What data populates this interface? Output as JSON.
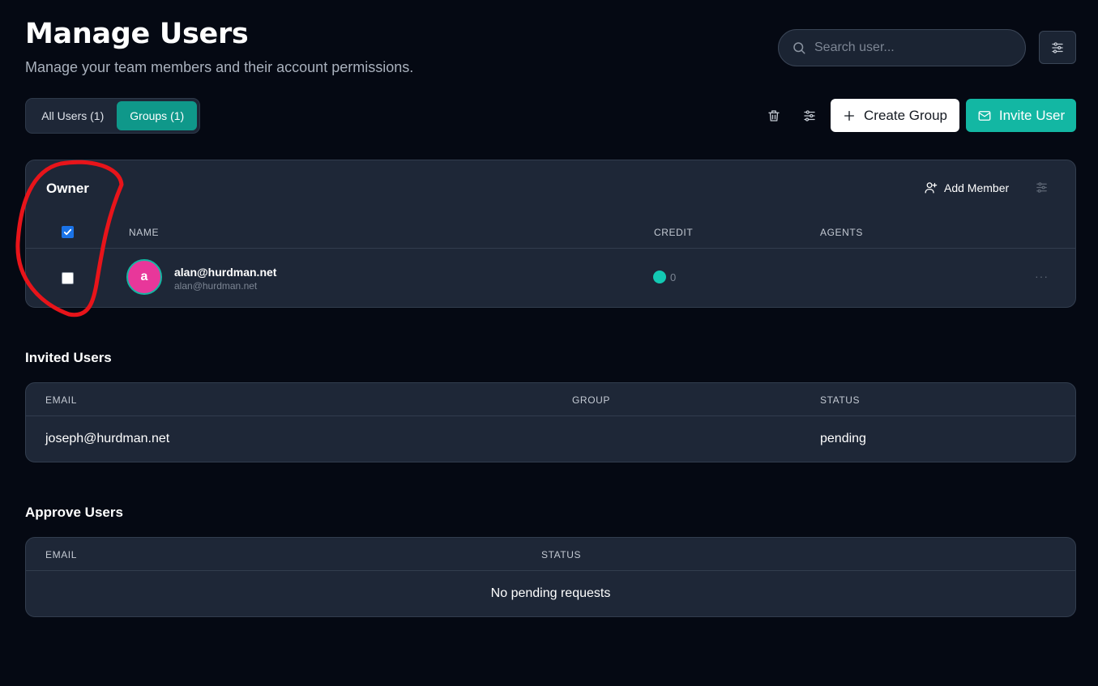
{
  "header": {
    "title": "Manage Users",
    "subtitle": "Manage your team members and their account permissions."
  },
  "search": {
    "placeholder": "Search user..."
  },
  "tabs": [
    {
      "label": "All Users (1)",
      "active": false
    },
    {
      "label": "Groups (1)",
      "active": true
    }
  ],
  "toolbar": {
    "delete_icon": "trash-icon",
    "filter_icon": "sliders-icon",
    "create_group_label": "Create Group",
    "invite_user_label": "Invite User"
  },
  "owner_group": {
    "title": "Owner",
    "add_member_label": "Add Member",
    "columns": [
      "NAME",
      "CREDIT",
      "AGENTS"
    ],
    "header_checkbox_checked": true,
    "members": [
      {
        "avatar_letter": "a",
        "name": "alan@hurdman.net",
        "email": "alan@hurdman.net",
        "credit": "0",
        "agents": "",
        "checked": false
      }
    ]
  },
  "invited_users": {
    "title": "Invited Users",
    "columns": [
      "EMAIL",
      "GROUP",
      "STATUS"
    ],
    "rows": [
      {
        "email": "joseph@hurdman.net",
        "group": "",
        "status": "pending"
      }
    ]
  },
  "approve_users": {
    "title": "Approve Users",
    "columns": [
      "EMAIL",
      "STATUS"
    ],
    "empty_message": "No pending requests"
  },
  "colors": {
    "background": "#050913",
    "card": "#1e2737",
    "accent": "#13b7a3",
    "avatar": "#e8379a",
    "annotation": "#e8141a"
  }
}
